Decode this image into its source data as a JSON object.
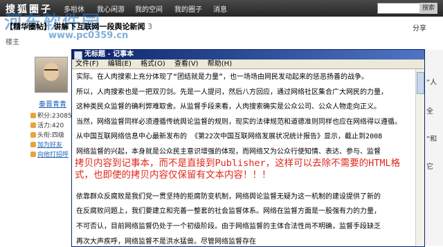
{
  "topbar": {
    "logo": "搜狐圈子",
    "links": [
      "多啦休",
      "我心闲游",
      "我的空间",
      "我的圈子",
      "消息"
    ],
    "search_placeholder": "",
    "search_button": "搜索"
  },
  "watermark": {
    "text": "河东软件园",
    "url": "www.pc0359.cn"
  },
  "thread": {
    "tag": "【精华圈帖】",
    "title": "讲解下互联网一段舆论新闻",
    "count": "3"
  },
  "share_label": "分享",
  "byline": "楼主",
  "user": {
    "name": "秦晋青青",
    "stats": [
      "积分:23085",
      "活力:420",
      "头衔:四级"
    ],
    "links": [
      "加为好友",
      "向他打招呼"
    ]
  },
  "notepad": {
    "title": "无标题 - 记事本",
    "menu": [
      "文件(F)",
      "编辑(E)",
      "格式(O)",
      "查看(V)",
      "帮助(H)"
    ],
    "lines": [
      "实际。在人肉搜索上充分体现了“团结就是力量”，也一场场由网民发动起来的惩恶扬善的战争。",
      "所以，人肉搜索也是一把双刃剑。先是一人提问，然后八方回应，通过网络社区集合广大网民的力量，",
      "这种类民众监督的确利弊难取舍。从监督手段来看，人肉搜索确实是公众公司、公众人物走向正义。",
      "当然，网络监督同样必须遵循传统舆论监督的规则，现实的法律规范和道德准则同样也应在网络得以遵循。",
      "从中国互联网络信息中心最新发布的 《第22次中国互联网络发展状况统计报告》显示，截止到2008",
      "网络监督的兴起，本身就是公众民主意识增强的体现，而网络又为公众行使知情、表达、参与、监督",
      "",
      "",
      "依靠群众反腐败是我们党一贯坚持的拒腐防变机制，网络舆论监督无疑为这一机制的建设提供了新的",
      "在反腐败问题上，我们要建立和完善一整套的社会监督体系。网络在监督方面是一股强有力的力量，",
      "不可否认，目前网络监督仍处于一个初级阶段。由于网络监督的主体合法性尚不明确，监督手段缺乏",
      "再次大声疾呼，网络监督不是洪水猛兽。尽管网络监督存在"
    ]
  },
  "annotation": "拷贝内容到记事本，而不是直接到Publisher，这样可以去除不需要的HTML格式，也即使的拷贝内容仅保留有文本内容！！！",
  "right_strip": [
    "“人",
    "全",
    "”和",
    "它"
  ]
}
